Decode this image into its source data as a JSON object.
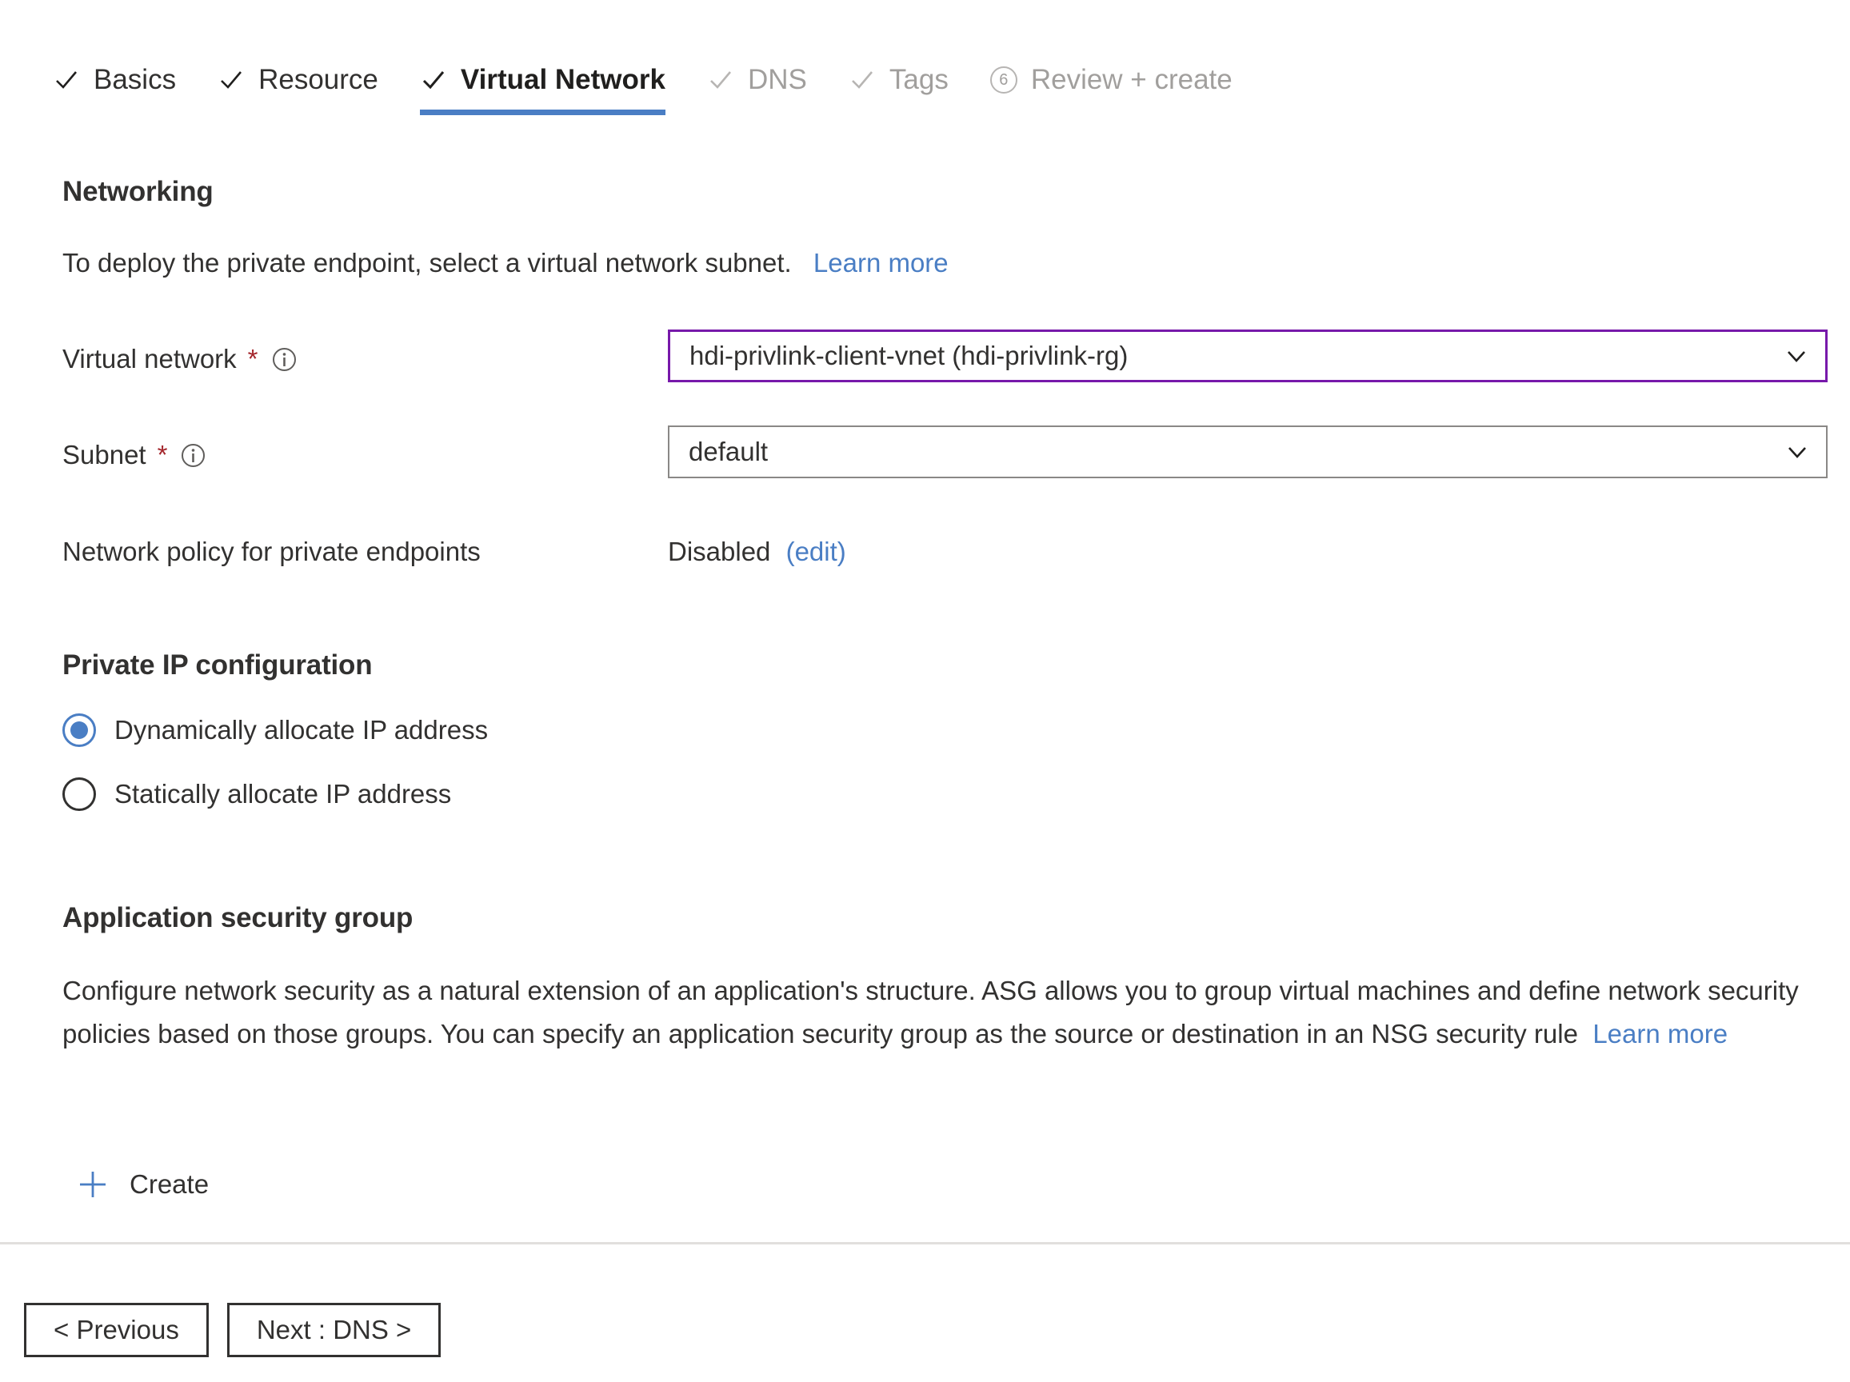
{
  "wizard": {
    "tabs": [
      {
        "label": "Basics",
        "state": "done",
        "icon": "check-icon"
      },
      {
        "label": "Resource",
        "state": "done",
        "icon": "check-icon"
      },
      {
        "label": "Virtual Network",
        "state": "active",
        "icon": "check-icon"
      },
      {
        "label": "DNS",
        "state": "disabled",
        "icon": "check-icon"
      },
      {
        "label": "Tags",
        "state": "disabled",
        "icon": "check-icon"
      },
      {
        "label": "Review + create",
        "state": "disabled",
        "icon": "step-number-badge",
        "badge": "6"
      }
    ]
  },
  "networking": {
    "title": "Networking",
    "description": "To deploy the private endpoint, select a virtual network subnet.",
    "learn_more": "Learn more",
    "virtual_network": {
      "label": "Virtual network",
      "required_marker": "*",
      "info_icon": "info-icon",
      "value": "hdi-privlink-client-vnet (hdi-privlink-rg)"
    },
    "subnet": {
      "label": "Subnet",
      "required_marker": "*",
      "info_icon": "info-icon",
      "value": "default"
    },
    "network_policy": {
      "label": "Network policy for private endpoints",
      "value": "Disabled",
      "edit_link": "(edit)"
    }
  },
  "private_ip": {
    "title": "Private IP configuration",
    "options": [
      {
        "label": "Dynamically allocate IP address",
        "selected": true
      },
      {
        "label": "Statically allocate IP address",
        "selected": false
      }
    ]
  },
  "asg": {
    "title": "Application security group",
    "description": "Configure network security as a natural extension of an application's structure. ASG allows you to group virtual machines and define network security policies based on those groups. You can specify an application security group as the source or destination in an NSG security rule",
    "learn_more": "Learn more",
    "create_label": "Create",
    "create_icon": "plus-icon"
  },
  "footer": {
    "previous_label": "< Previous",
    "next_label": "Next : DNS >"
  },
  "colors": {
    "accent_blue": "#4a7ec4",
    "link_blue": "#4a7ec4",
    "focus_purple": "#7719aa",
    "required_red": "#a4262c",
    "border_gray": "#8a8886",
    "disabled_gray": "#a19f9d"
  }
}
